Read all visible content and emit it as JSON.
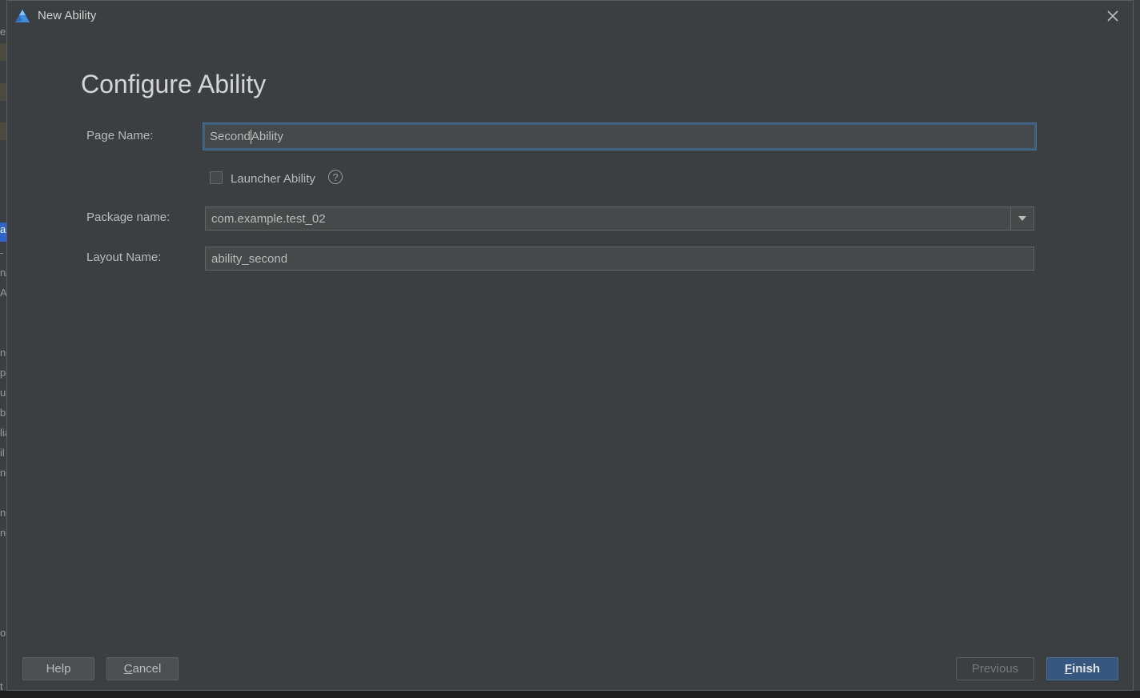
{
  "window": {
    "title": "New Ability"
  },
  "page": {
    "heading": "Configure Ability"
  },
  "form": {
    "page_name": {
      "label": "Page Name:",
      "value_before_caret": "Second",
      "value_after_caret": "Ability"
    },
    "launcher": {
      "label": "Launcher Ability",
      "checked": false,
      "help_glyph": "?"
    },
    "package_name": {
      "label": "Package name:",
      "value": "com.example.test_02"
    },
    "layout_name": {
      "label": "Layout Name:",
      "value": "ability_second"
    }
  },
  "buttons": {
    "help": "Help",
    "cancel_mnemonic": "C",
    "cancel_rest": "ancel",
    "previous": "Previous",
    "finish_mnemonic": "F",
    "finish_rest": "inish"
  },
  "background": {
    "chars": [
      "e",
      "a",
      "-",
      "n/",
      "Ap",
      "ne",
      "ph",
      "u",
      "b",
      "lia",
      "il",
      "ne",
      "ne",
      "n",
      "or",
      "t"
    ]
  },
  "colors": {
    "dialog_bg": "#3c3f41",
    "primary_button": "#365880",
    "focus_border": "#3d6185"
  }
}
